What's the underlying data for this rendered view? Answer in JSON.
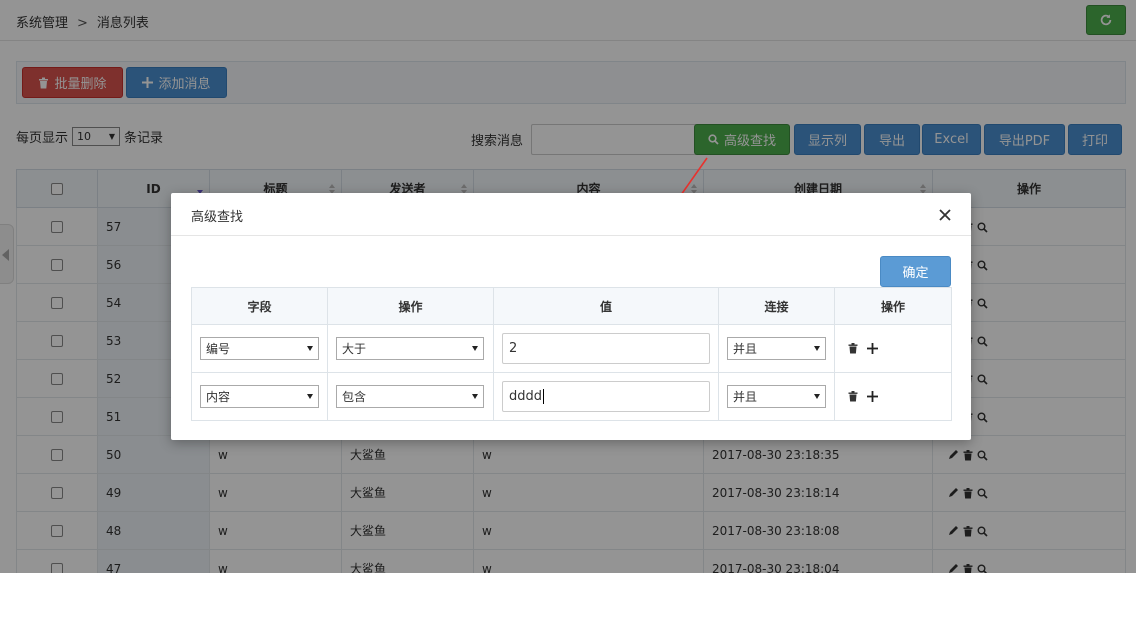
{
  "breadcrumb": {
    "root": "系统管理",
    "separator": ">",
    "current": "消息列表"
  },
  "toolbar": {
    "batch_delete_label": "批量删除",
    "add_message_label": "添加消息"
  },
  "list_controls": {
    "per_page_prefix": "每页显示",
    "per_page_value": "10",
    "per_page_suffix": "条记录",
    "search_label": "搜索消息",
    "search_value": ""
  },
  "action_buttons": {
    "advanced_search": "高级查找",
    "show_columns": "显示列",
    "export": "导出",
    "excel": "Excel",
    "export_pdf": "导出PDF",
    "print": "打印"
  },
  "table": {
    "columns": [
      "ID",
      "标题",
      "发送者",
      "内容",
      "创建日期",
      "操作"
    ],
    "rows": [
      {
        "id": "57",
        "title": "",
        "sender": "",
        "content": "",
        "date": ""
      },
      {
        "id": "56",
        "title": "",
        "sender": "",
        "content": "",
        "date": ""
      },
      {
        "id": "54",
        "title": "",
        "sender": "",
        "content": "",
        "date": ""
      },
      {
        "id": "53",
        "title": "",
        "sender": "",
        "content": "",
        "date": ""
      },
      {
        "id": "52",
        "title": "",
        "sender": "",
        "content": "",
        "date": ""
      },
      {
        "id": "51",
        "title": "",
        "sender": "",
        "content": "",
        "date": ""
      },
      {
        "id": "50",
        "title": "w",
        "sender": "大鲨鱼",
        "content": "w",
        "date": "2017-08-30 23:18:35"
      },
      {
        "id": "49",
        "title": "w",
        "sender": "大鲨鱼",
        "content": "w",
        "date": "2017-08-30 23:18:14"
      },
      {
        "id": "48",
        "title": "w",
        "sender": "大鲨鱼",
        "content": "w",
        "date": "2017-08-30 23:18:08"
      },
      {
        "id": "47",
        "title": "w",
        "sender": "大鲨鱼",
        "content": "w",
        "date": "2017-08-30 23:18:04"
      }
    ]
  },
  "modal": {
    "title": "高级查找",
    "confirm_label": "确定",
    "columns": [
      "字段",
      "操作",
      "值",
      "连接",
      "操作"
    ],
    "rows": [
      {
        "field": "编号",
        "operator": "大于",
        "value": "2",
        "join": "并且"
      },
      {
        "field": "内容",
        "operator": "包含",
        "value": "dddd",
        "join": "并且"
      }
    ]
  },
  "colors": {
    "danger": "#d9534f",
    "primary": "#4a8fd0",
    "success": "#4cae4c",
    "arrow": "#e8322e"
  }
}
